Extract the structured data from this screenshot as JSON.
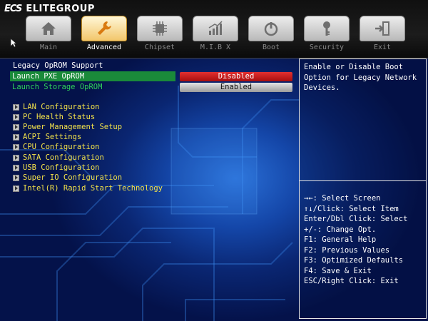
{
  "brand": {
    "mark": "ECS",
    "name": "ELITEGROUP"
  },
  "tabs": [
    {
      "label": "Main",
      "icon": "home-icon"
    },
    {
      "label": "Advanced",
      "icon": "wrench-icon"
    },
    {
      "label": "Chipset",
      "icon": "chip-icon"
    },
    {
      "label": "M.I.B X",
      "icon": "chart-icon"
    },
    {
      "label": "Boot",
      "icon": "power-icon"
    },
    {
      "label": "Security",
      "icon": "key-icon"
    },
    {
      "label": "Exit",
      "icon": "exit-icon"
    }
  ],
  "active_tab": "Advanced",
  "main": {
    "section_title": "Legacy OpROM Support",
    "options": [
      {
        "label": "Launch PXE OpROM",
        "value": "Disabled"
      },
      {
        "label": "Launch Storage OpROM",
        "value": "Enabled"
      }
    ],
    "submenus": [
      "LAN Configuration",
      "PC Health Status",
      "Power Management Setup",
      "ACPI Settings",
      "CPU Configuration",
      "SATA Configuration",
      "USB Configuration",
      "Super IO Configuration",
      "Intel(R) Rapid Start Technology"
    ]
  },
  "help": {
    "description": "Enable or Disable Boot Option for Legacy Network Devices.",
    "keys": [
      "→←: Select Screen",
      "↑↓/Click: Select Item",
      "Enter/Dbl Click: Select",
      "+/-: Change Opt.",
      "F1: General Help",
      "F2: Previous Values",
      "F3: Optimized Defaults",
      "F4: Save & Exit",
      "ESC/Right Click: Exit"
    ]
  },
  "colors": {
    "selected_row": "#1a8a3a",
    "disabled_value": "#d42020",
    "submenu_text": "#f2e24a",
    "background": "#04124a"
  }
}
